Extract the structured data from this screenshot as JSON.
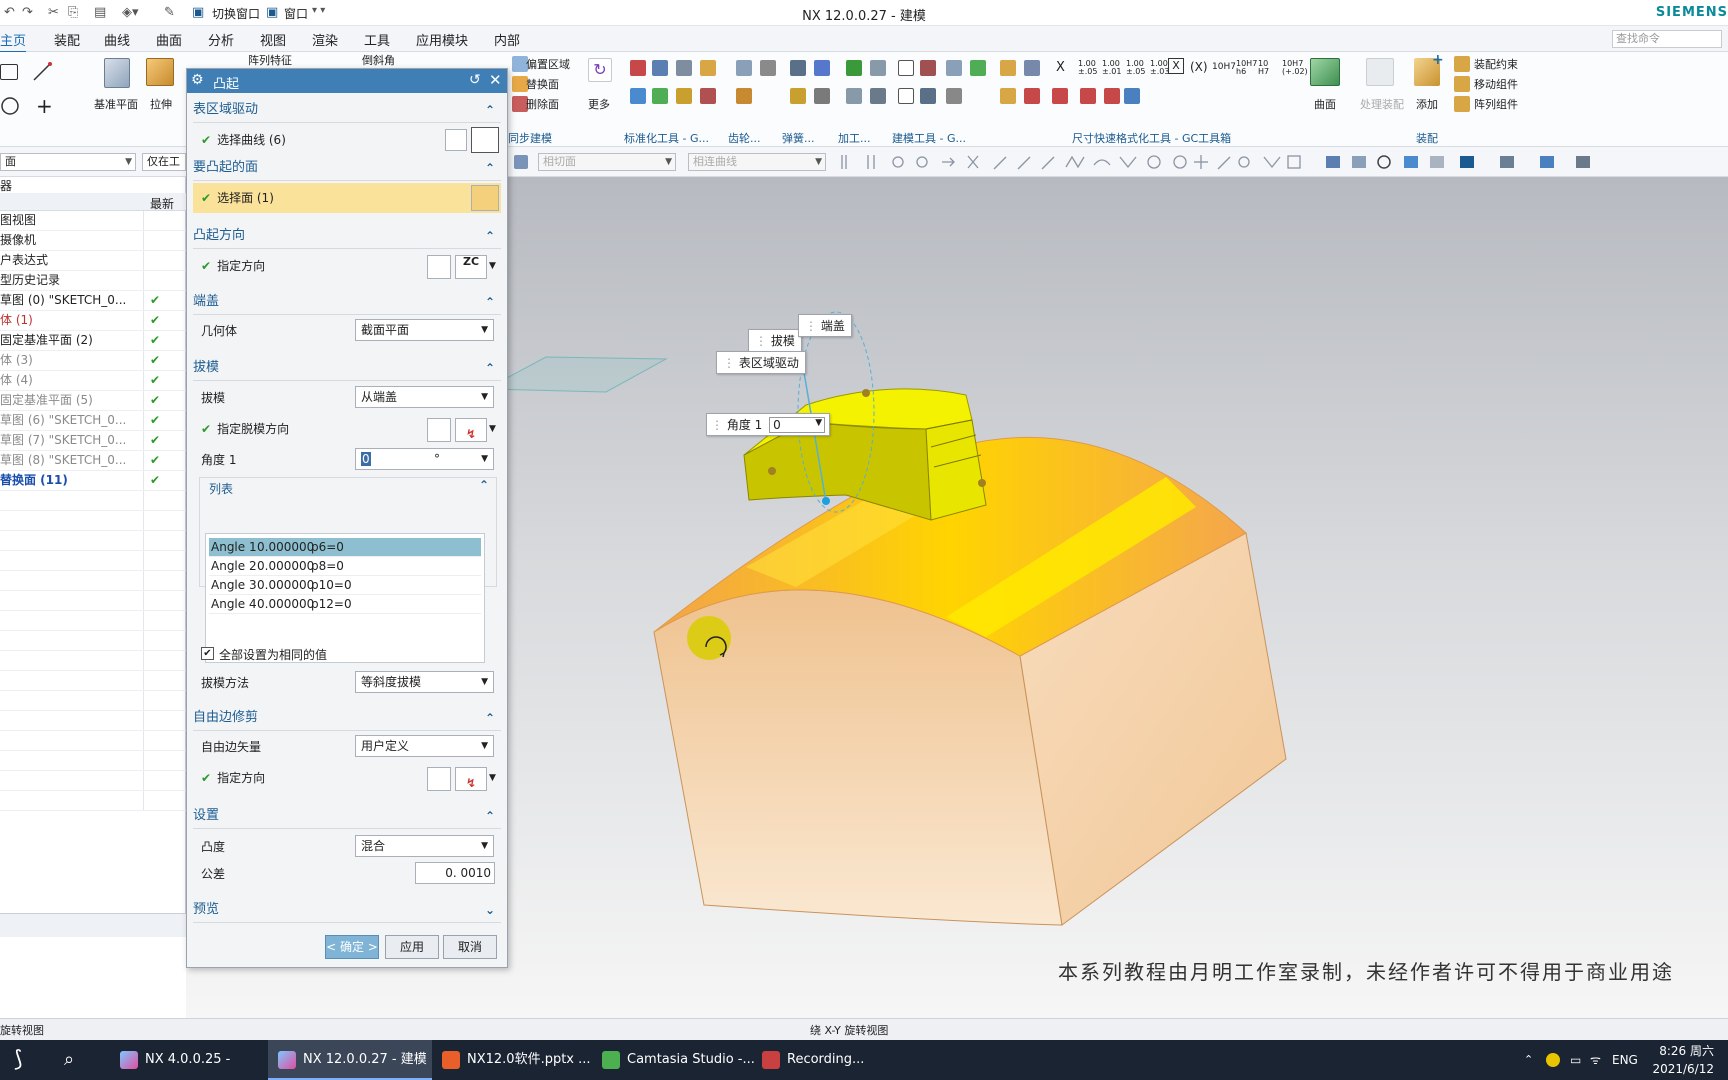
{
  "window": {
    "title": "NX 12.0.0.27 - 建模",
    "brand": "SIEMENS",
    "switch_window": "切换窗口",
    "window_menu": "窗口"
  },
  "menu": [
    "主页",
    "装配",
    "曲线",
    "曲面",
    "分析",
    "视图",
    "渲染",
    "工具",
    "应用模块",
    "内部"
  ],
  "search_placeholder": "查找命令",
  "ribbon": {
    "labels": {
      "datum_plane": "基准平面",
      "extrude": "拉伸",
      "pattern_feature": "阵列特征",
      "chamfer": "倒斜角",
      "offset_region": "偏置区域",
      "replace_face": "替换面",
      "delete_face": "删除面",
      "more": "更多",
      "surface": "曲面",
      "process_assembly": "处理装配",
      "add": "添加",
      "assembly_constraint": "装配约束",
      "move_component": "移动组件",
      "pattern_component": "阵列组件"
    },
    "groups": [
      "同步建模",
      "标准化工具 - G...",
      "齿轮...",
      "弹簧...",
      "加工...",
      "建模工具 - G...",
      "尺寸快速格式化工具 - GC工具箱",
      "装配"
    ],
    "dim_labels": [
      "X",
      "(X)",
      "10H7"
    ]
  },
  "toolbar2": {
    "filter_left": "面",
    "filter_scope": "仅在工",
    "face_rule": "相切面",
    "curve_rule": "相连曲线"
  },
  "navigator": {
    "header": "器",
    "col_latest": "最新",
    "rows": [
      {
        "label": "图视图",
        "check": ""
      },
      {
        "label": "摄像机",
        "check": ""
      },
      {
        "label": "户表达式",
        "check": ""
      },
      {
        "label": "型历史记录",
        "check": ""
      },
      {
        "label": "草图 (0) \"SKETCH_0...",
        "check": "✔"
      },
      {
        "label": "体 (1)",
        "check": "✔"
      },
      {
        "label": "固定基准平面 (2)",
        "check": "✔"
      },
      {
        "label": "体 (3)",
        "check": "✔"
      },
      {
        "label": "体 (4)",
        "check": "✔"
      },
      {
        "label": "固定基准平面 (5)",
        "check": "✔"
      },
      {
        "label": "草图 (6) \"SKETCH_0...",
        "check": "✔"
      },
      {
        "label": "草图 (7) \"SKETCH_0...",
        "check": "✔"
      },
      {
        "label": "草图 (8) \"SKETCH_0...",
        "check": "✔"
      },
      {
        "label": "替换面 (11)",
        "check": "✔"
      }
    ]
  },
  "dialog": {
    "title": "凸起",
    "sections": {
      "region": "表区域驱动",
      "face": "要凸起的面",
      "direction": "凸起方向",
      "cap": "端盖",
      "draft": "拔模",
      "free_edge": "自由边修剪",
      "settings": "设置",
      "preview": "预览"
    },
    "select_curve": "选择曲线 (6)",
    "select_face": "选择面 (1)",
    "specify_direction": "指定方向",
    "zc": "ZC",
    "geometry_label": "几何体",
    "geometry_value": "截面平面",
    "draft_label": "拔模",
    "draft_value": "从端盖",
    "draw_direction": "指定脱模方向",
    "angle1_label": "角度 1",
    "angle1_value": "0",
    "angle_unit": "°",
    "list_title": "列表",
    "list": [
      {
        "name": "Angle 1",
        "value": "0.000000",
        "expr": "p6=0"
      },
      {
        "name": "Angle 2",
        "value": "0.000000",
        "expr": "p8=0"
      },
      {
        "name": "Angle 3",
        "value": "0.000000",
        "expr": "p10=0"
      },
      {
        "name": "Angle 4",
        "value": "0.000000",
        "expr": "p12=0"
      }
    ],
    "set_all_same": "全部设置为相同的值",
    "draft_method_label": "拔模方法",
    "draft_method_value": "等斜度拔模",
    "free_edge_vector_label": "自由边矢量",
    "free_edge_vector_value": "用户定义",
    "convexity_label": "凸度",
    "convexity_value": "混合",
    "tolerance_label": "公差",
    "tolerance_value": "0. 0010",
    "ok": "< 确定 >",
    "apply": "应用",
    "cancel": "取消"
  },
  "viewport": {
    "callouts": {
      "draft": "拔模",
      "cap": "端盖",
      "region": "表区域驱动",
      "angle_label": "角度 1",
      "angle_value": "0"
    },
    "watermark": "本系列教程由月明工作室录制，未经作者许可不得用于商业用途"
  },
  "status": {
    "left": "旋转视图",
    "center": "绕 X-Y 旋转视图"
  },
  "taskbar": {
    "items": [
      "NX 4.0.0.25 -",
      "NX 12.0.0.27 - 建模",
      "NX12.0软件.pptx ...",
      "Camtasia Studio -...",
      "Recording..."
    ],
    "lang": "ENG",
    "time": "8:26 周六",
    "date": "2021/6/12"
  },
  "colors": {
    "accent": "#3f7fb6",
    "body": "#f2c79a",
    "bulge": "#d6d600",
    "highlight_face": "#ffe900"
  }
}
